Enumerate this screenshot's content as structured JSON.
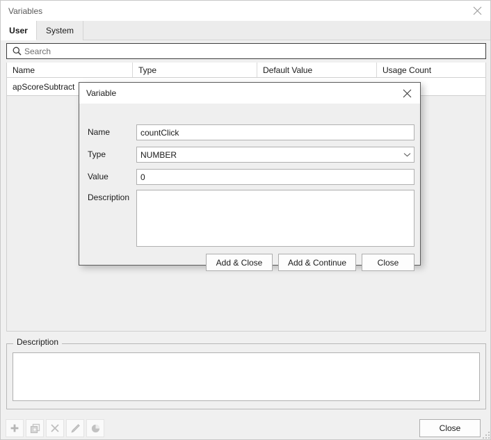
{
  "window": {
    "title": "Variables",
    "close_icon": "close-icon"
  },
  "tabs": [
    {
      "label": "User",
      "active": true
    },
    {
      "label": "System",
      "active": false
    }
  ],
  "search": {
    "placeholder": "Search",
    "value": "",
    "icon": "search-icon"
  },
  "table": {
    "columns": [
      "Name",
      "Type",
      "Default Value",
      "Usage Count"
    ],
    "rows": [
      {
        "name": "apScoreSubtract",
        "type": "",
        "default_value": "",
        "usage_count": ""
      }
    ]
  },
  "description_panel": {
    "legend": "Description",
    "value": "",
    "placeholder": ""
  },
  "toolbar": {
    "buttons": [
      {
        "name": "add-variable-button",
        "icon": "plus-icon"
      },
      {
        "name": "duplicate-variable-button",
        "icon": "duplicate-icon"
      },
      {
        "name": "delete-variable-button",
        "icon": "close-x-icon"
      },
      {
        "name": "edit-variable-button",
        "icon": "pencil-icon"
      },
      {
        "name": "usage-variable-button",
        "icon": "pie-chart-icon"
      }
    ],
    "close_label": "Close"
  },
  "dialog": {
    "title": "Variable",
    "close_icon": "close-icon",
    "fields": {
      "name_label": "Name",
      "name_value": "countClick",
      "type_label": "Type",
      "type_value": "NUMBER",
      "value_label": "Value",
      "value_value": "0",
      "description_label": "Description",
      "description_value": ""
    },
    "buttons": {
      "add_close": "Add & Close",
      "add_continue": "Add & Continue",
      "close": "Close"
    }
  },
  "colors": {
    "window_bg": "#f0f0f0",
    "titlebar_bg": "#ffffff",
    "tab_active_bg": "#ffffff",
    "tab_inactive_bg": "#ececec",
    "border": "#b0b0b0",
    "text": "#1a1a1a"
  }
}
